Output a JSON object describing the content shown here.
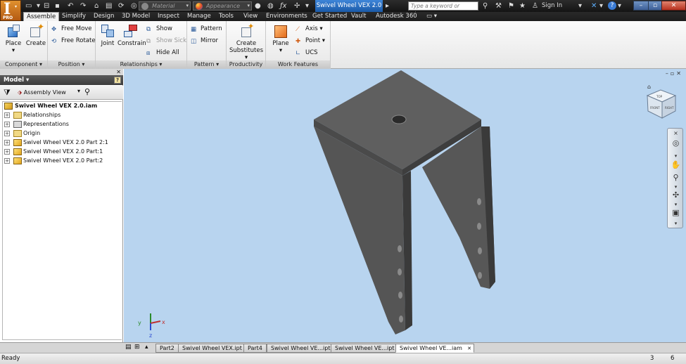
{
  "titlebar": {
    "logo_letter": "I",
    "logo_sub": "PRO",
    "material_placeholder": "Material",
    "appearance_placeholder": "Appearance",
    "document_title": "Swivel Wheel VEX 2.0",
    "search_placeholder": "Type a keyword or phrase",
    "sign_in": "Sign In",
    "help": "?"
  },
  "tabs": [
    "Assemble",
    "Simplify",
    "Design",
    "3D Model",
    "Inspect",
    "Manage",
    "Tools",
    "View",
    "Environments",
    "Get Started",
    "Vault",
    "Autodesk 360"
  ],
  "active_tab": "Assemble",
  "ribbon": {
    "component": {
      "title": "Component",
      "place": "Place",
      "create": "Create"
    },
    "position": {
      "title": "Position",
      "free_move": "Free Move",
      "free_rotate": "Free Rotate"
    },
    "relationships": {
      "title": "Relationships",
      "joint": "Joint",
      "constrain": "Constrain",
      "show": "Show",
      "show_sick": "Show Sick",
      "hide_all": "Hide All"
    },
    "pattern": {
      "title": "Pattern",
      "pattern": "Pattern",
      "mirror": "Mirror"
    },
    "productivity": {
      "title": "Productivity",
      "create_substitutes_1": "Create",
      "create_substitutes_2": "Substitutes"
    },
    "work_features": {
      "title": "Work Features",
      "plane": "Plane",
      "axis": "Axis",
      "point": "Point",
      "ucs": "UCS"
    }
  },
  "browser": {
    "title": "Model",
    "view_label": "Assembly View",
    "root": "Swivel Wheel VEX 2.0.iam",
    "items": [
      {
        "label": "Relationships",
        "icon": "folder-icon"
      },
      {
        "label": "Representations",
        "icon": "representations-icon"
      },
      {
        "label": "Origin",
        "icon": "folder-icon"
      },
      {
        "label": "Swivel Wheel VEX 2.0 Part 2:1",
        "icon": "part-icon"
      },
      {
        "label": "Swivel Wheel VEX 2.0 Part:1",
        "icon": "part-icon"
      },
      {
        "label": "Swivel Wheel VEX 2.0 Part:2",
        "icon": "part-icon"
      }
    ]
  },
  "viewcube": {
    "top": "TOP",
    "front": "FRONT",
    "right": "RIGHT"
  },
  "doc_tabs": [
    {
      "label": "Part2",
      "active": false
    },
    {
      "label": "Swivel Wheel VEX.ipt",
      "active": false
    },
    {
      "label": "Part4",
      "active": false
    },
    {
      "label": "Swivel Wheel VE...ipt",
      "active": false
    },
    {
      "label": "Swivel Wheel VE...ipt",
      "active": false
    },
    {
      "label": "Swivel Wheel VE...iam",
      "active": true
    }
  ],
  "status": {
    "text": "Ready",
    "count1": "3",
    "count2": "6"
  },
  "colors": {
    "accent_blue": "#1b5aa8",
    "viewport_bg": "#b8d4ef",
    "model_gray": "#5e5e5e",
    "logo_orange": "#d27a25"
  }
}
